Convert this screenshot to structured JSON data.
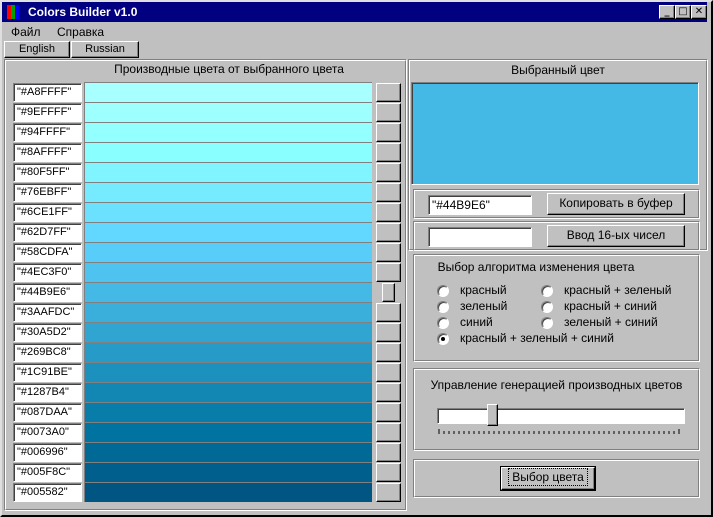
{
  "window": {
    "title": "Colors Builder v1.0",
    "minimize_icon": "minimize-icon",
    "maximize_icon": "maximize-icon",
    "close_icon": "close-icon",
    "app_icon_colors": [
      "#ff0000",
      "#00a000",
      "#0000ff"
    ]
  },
  "menu": {
    "file": "Файл",
    "help": "Справка"
  },
  "language_tabs": {
    "english": "English",
    "russian": "Russian"
  },
  "derived": {
    "title": "Производные цвета от выбранного цвета",
    "selected_index": 10,
    "colors": [
      {
        "label": "\"#A8FFFF\"",
        "hex": "#A8FFFF"
      },
      {
        "label": "\"#9EFFFF\"",
        "hex": "#9EFFFF"
      },
      {
        "label": "\"#94FFFF\"",
        "hex": "#94FFFF"
      },
      {
        "label": "\"#8AFFFF\"",
        "hex": "#8AFFFF"
      },
      {
        "label": "\"#80F5FF\"",
        "hex": "#80F5FF"
      },
      {
        "label": "\"#76EBFF\"",
        "hex": "#76EBFF"
      },
      {
        "label": "\"#6CE1FF\"",
        "hex": "#6CE1FF"
      },
      {
        "label": "\"#62D7FF\"",
        "hex": "#62D7FF"
      },
      {
        "label": "\"#58CDFA\"",
        "hex": "#58CDFA"
      },
      {
        "label": "\"#4EC3F0\"",
        "hex": "#4EC3F0"
      },
      {
        "label": "\"#44B9E6\"",
        "hex": "#44B9E6"
      },
      {
        "label": "\"#3AAFDC\"",
        "hex": "#3AAFDC"
      },
      {
        "label": "\"#30A5D2\"",
        "hex": "#30A5D2"
      },
      {
        "label": "\"#269BC8\"",
        "hex": "#269BC8"
      },
      {
        "label": "\"#1C91BE\"",
        "hex": "#1C91BE"
      },
      {
        "label": "\"#1287B4\"",
        "hex": "#1287B4"
      },
      {
        "label": "\"#087DAA\"",
        "hex": "#087DAA"
      },
      {
        "label": "\"#0073A0\"",
        "hex": "#0073A0"
      },
      {
        "label": "\"#006996\"",
        "hex": "#006996"
      },
      {
        "label": "\"#005F8C\"",
        "hex": "#005F8C"
      },
      {
        "label": "\"#005582\"",
        "hex": "#005582"
      }
    ]
  },
  "selected": {
    "title": "Выбранный цвет",
    "color": "#44B9E6",
    "hex_value": "\"#44B9E6\"",
    "copy_button": "Копировать в буфер",
    "hex_input_value": "",
    "hex_input_button": "Ввод 16-ых чисел"
  },
  "algorithm": {
    "title": "Выбор алгоритма изменения цвета",
    "options": [
      {
        "label": "красный",
        "checked": false
      },
      {
        "label": "зеленый",
        "checked": false
      },
      {
        "label": "синий",
        "checked": false
      },
      {
        "label": "красный + зеленый + синий",
        "checked": true
      },
      {
        "label": "красный + зеленый",
        "checked": false
      },
      {
        "label": "красный + синий",
        "checked": false
      },
      {
        "label": "зеленый + синий",
        "checked": false
      }
    ]
  },
  "generation": {
    "title": "Управление генерацией производных цветов",
    "slider_fraction": 0.21
  },
  "pick_button": "Выбор цвета"
}
